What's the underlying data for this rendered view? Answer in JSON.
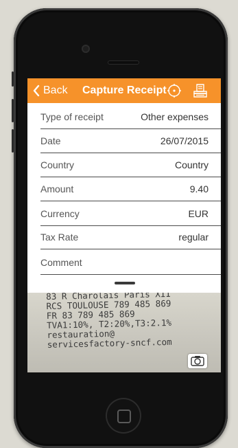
{
  "nav": {
    "back_label": "Back",
    "title": "Capture Receipt",
    "locate_icon": "crosshair-icon",
    "receipt_icon": "receipt-stack-icon",
    "accent_color": "#f6922a"
  },
  "form": {
    "fields": [
      {
        "label": "Type of receipt",
        "value": "Other expenses"
      },
      {
        "label": "Date",
        "value": "26/07/2015"
      },
      {
        "label": "Country",
        "value": "Country"
      },
      {
        "label": "Amount",
        "value": "9.40"
      },
      {
        "label": "Currency",
        "value": "EUR"
      },
      {
        "label": "Tax Rate",
        "value": "regular"
      },
      {
        "label": "Comment",
        "value": ""
      }
    ]
  },
  "receipt_photo": {
    "lines": [
      "83 R Charolais Paris XII",
      "RCS TOULOUSE 789 485 869",
      "FR 83 789 485 869",
      "TVA1:10%, T2:20%,T3:2.1%",
      "restauration@",
      "servicesfactory-sncf.com"
    ],
    "camera_icon": "camera-icon"
  },
  "device": {
    "home_icon": "home-button-icon"
  }
}
